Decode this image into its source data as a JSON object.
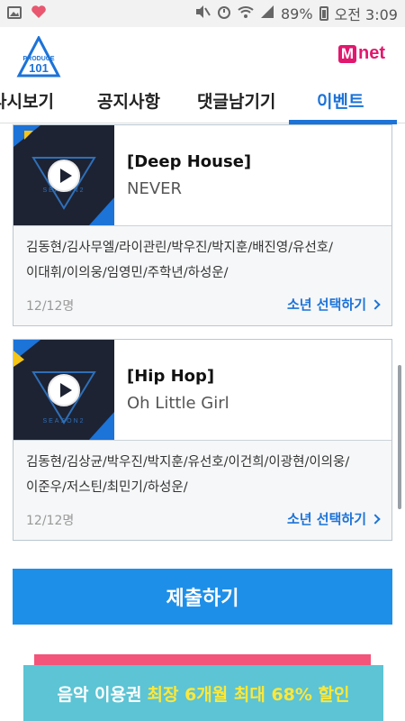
{
  "status_bar": {
    "battery_percent": "89%",
    "time": "오전 3:09",
    "left_icons": [
      "gallery-icon",
      "heart-app-icon"
    ],
    "right_icons": [
      "mute-icon",
      "alarm-icon",
      "wifi-icon",
      "signal-icon",
      "battery-icon"
    ]
  },
  "header": {
    "logo_top": "PRODUCE",
    "logo_number": "101",
    "brand_m": "M",
    "brand_net": "net"
  },
  "tabs": [
    {
      "label": "다시보기",
      "active": false
    },
    {
      "label": "공지사항",
      "active": false
    },
    {
      "label": "댓글남기기",
      "active": false
    },
    {
      "label": "이벤트",
      "active": true
    }
  ],
  "cards": [
    {
      "genre": "[Deep House]",
      "title": "NEVER",
      "members_line1": "김동현/김사무엘/라이관린/박우진/박지훈/배진영/유선호/",
      "members_line2": "이대휘/이의웅/임영민/주학년/하성운/",
      "count": "12/12명",
      "select_label": "소년 선택하기"
    },
    {
      "genre": "[Hip Hop]",
      "title": "Oh Little Girl",
      "members_line1": "김동현/김상균/박우진/박지훈/유선호/이건희/이광현/이의웅/",
      "members_line2": "이준우/저스틴/최민기/하성운/",
      "count": "12/12명",
      "select_label": "소년 선택하기"
    }
  ],
  "submit_label": "제출하기",
  "banner": {
    "text": "음악 이용권",
    "highlight": "최장 6개월 최대 68% 할인"
  },
  "colors": {
    "accent": "#1c73d8",
    "submit": "#1e8fe8",
    "brand_pink": "#e1186e",
    "banner": "#5cc4d4",
    "banner_highlight": "#fde83a"
  }
}
